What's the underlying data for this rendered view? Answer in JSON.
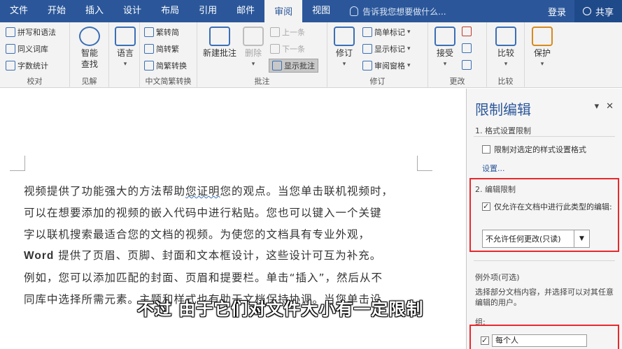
{
  "tabs": [
    "文件",
    "开始",
    "插入",
    "设计",
    "布局",
    "引用",
    "邮件",
    "审阅",
    "视图"
  ],
  "active_tab_index": 7,
  "tell_me": "告诉我您想要做什么...",
  "login": "登录",
  "share": "共享",
  "ribbon": {
    "proofing": {
      "label": "校对",
      "spell": "拼写和语法",
      "thesaurus": "同义词库",
      "wordcount": "字数统计"
    },
    "insights": {
      "label": "见解",
      "smart_lookup_1": "智能",
      "smart_lookup_2": "查找"
    },
    "language": {
      "label": "",
      "btn": "语言"
    },
    "chinese": {
      "label": "中文简繁转换",
      "to_trad": "繁转简",
      "to_simp": "简转繁",
      "convert": "简繁转换"
    },
    "comments": {
      "label": "批注",
      "new_1": "新建批注",
      "delete": "删除",
      "prev": "上一条",
      "next": "下一条",
      "show": "显示批注"
    },
    "tracking": {
      "label": "修订",
      "track": "修订",
      "simple_markup": "简单标记",
      "show_markup": "显示标记",
      "review_pane": "审阅窗格"
    },
    "changes": {
      "label": "更改",
      "accept": "接受"
    },
    "compare": {
      "label": "比较",
      "btn": "比较"
    },
    "protect": {
      "label": "",
      "btn": "保护"
    }
  },
  "document": {
    "lines": [
      {
        "pre": "视频提供了功能强大的方法帮助",
        "squiggle": "您证明",
        "post": "您的观点。当您单击联机视频时，"
      },
      {
        "text": "可以在想要添加的视频的嵌入代码中进行粘贴。您也可以键入一个关键"
      },
      {
        "text": "字以联机搜索最适合您的文档的视频。为使您的文档具有专业外观，"
      },
      {
        "bold": "Word",
        "post": " 提供了页眉、页脚、封面和文本框设计，这些设计可互为补充。"
      },
      {
        "text": "例如，您可以添加匹配的封面、页眉和提要栏。单击“插入”，然后从不"
      },
      {
        "text": "同库中选择所需元素。主题和样式也有助于文档保持协调。当您单击设"
      }
    ]
  },
  "subtitle": "不过 由于它们对文件大小有一定限制",
  "pane": {
    "title": "限制编辑",
    "section1_title": "1. 格式设置限制",
    "section1_checkbox": "限制对选定的样式设置格式",
    "section1_link": "设置...",
    "section2_title": "2. 编辑限制",
    "section2_checkbox": "仅允许在文档中进行此类型的编辑:",
    "section2_select": "不允许任何更改(只读)",
    "exceptions_title": "例外项(可选)",
    "exceptions_desc": "选择部分文档内容，并选择可以对其任意编辑的用户。",
    "groups_label": "组:",
    "everyone": "每个人"
  }
}
